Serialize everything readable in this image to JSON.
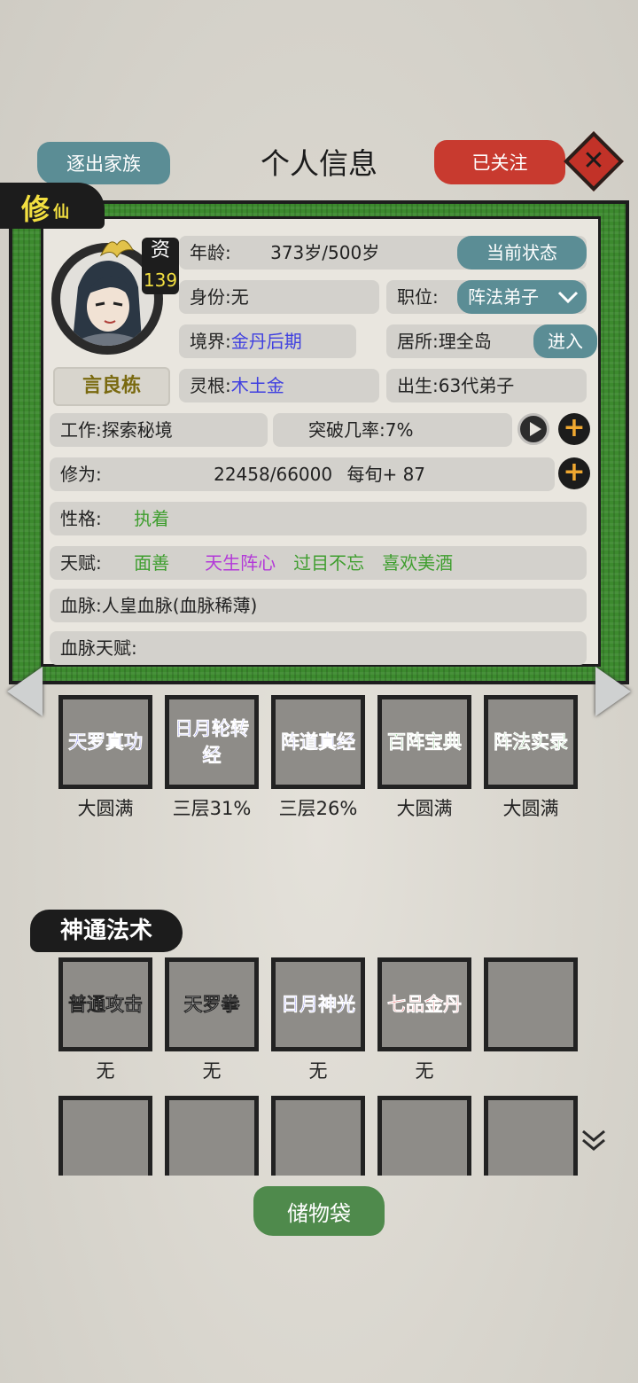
{
  "header": {
    "expel_label": "逐出家族",
    "title": "个人信息",
    "follow_label": "已关注",
    "close_symbol": "✕"
  },
  "profile_tab": {
    "big": "修",
    "small": "仙"
  },
  "character": {
    "aptitude_label": "资",
    "aptitude_value": "139",
    "name": "言良栋"
  },
  "info": {
    "age_label": "年龄:",
    "age_value": "373岁/500岁",
    "status_button": "当前状态",
    "identity_label": "身份:",
    "identity_value": "无",
    "position_label": "职位:",
    "position_value": "阵法弟子",
    "realm_label": "境界:",
    "realm_value": "金丹后期",
    "residence_label": "居所:",
    "residence_value": "理全岛",
    "enter_button": "进入",
    "root_label": "灵根:",
    "root_value": "木土金",
    "birth_label": "出生:",
    "birth_value": "63代弟子",
    "work_label": "工作:",
    "work_value": "探索秘境",
    "breakthrough_label": "突破几率:",
    "breakthrough_value": "7%",
    "cultivation_label": "修为:",
    "cultivation_value": "22458/66000",
    "cultivation_rate": "每旬+ 87",
    "personality_label": "性格:",
    "personality_value": "执着",
    "talent_label": "天赋:",
    "talents": [
      {
        "text": "面善",
        "color": "#3f9e2f"
      },
      {
        "text": "天生阵心",
        "color": "#b339d8"
      },
      {
        "text": "过目不忘",
        "color": "#3f9e2f"
      },
      {
        "text": "喜欢美酒",
        "color": "#3f9e2f"
      }
    ],
    "bloodline_label": "血脉:",
    "bloodline_value": "人皇血脉(血脉稀薄)",
    "bloodline_talent_label": "血脉天赋:"
  },
  "techniques": [
    {
      "name": "天罗真功",
      "level": "大圆满",
      "color": "#2b2bd8"
    },
    {
      "name": "日月轮转经",
      "level": "三层31%",
      "color": "#2b2bd8"
    },
    {
      "name": "阵道真经",
      "level": "三层26%",
      "color": "#2b2bd8"
    },
    {
      "name": "百阵宝典",
      "level": "大圆满",
      "color": "#1e8a1e"
    },
    {
      "name": "阵法实录",
      "level": "大圆满",
      "color": "#1e8a1e"
    }
  ],
  "spells_section": {
    "title": "神通法术",
    "spells": [
      {
        "name": "普通攻击",
        "level": "无",
        "color": "#ffffff"
      },
      {
        "name": "天罗拳",
        "level": "无",
        "color": "#ffffff"
      },
      {
        "name": "日月神光",
        "level": "无",
        "color": "#2b2bd8"
      },
      {
        "name": "七品金丹",
        "level": "无",
        "color": "#d81e1e"
      },
      {
        "name": "",
        "level": "",
        "color": "#ffffff"
      }
    ]
  },
  "storage_label": "储物袋"
}
